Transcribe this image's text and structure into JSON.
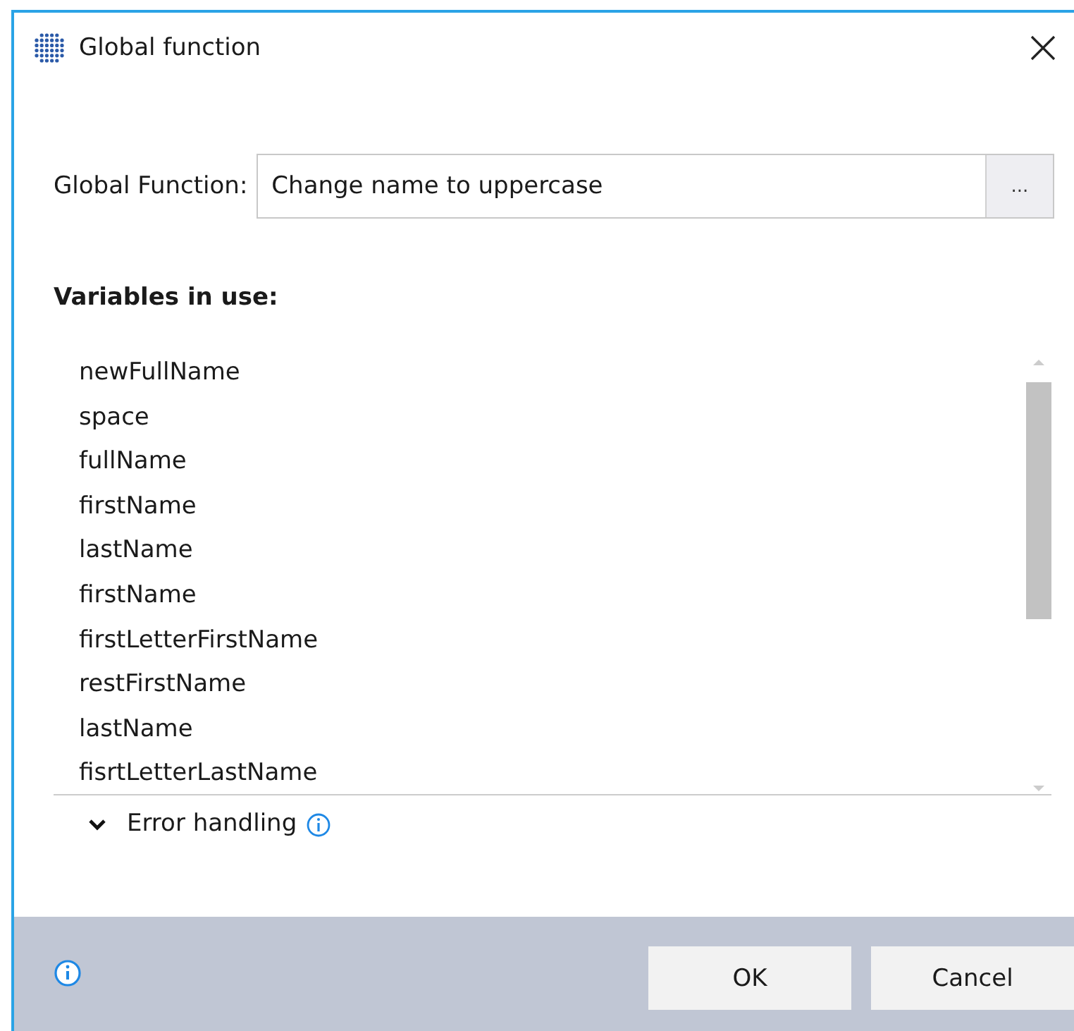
{
  "window": {
    "title": "Global function"
  },
  "global_function": {
    "label": "Global Function:",
    "value": "Change name to uppercase",
    "browse_button": "..."
  },
  "variables": {
    "heading": "Variables in use:",
    "items": [
      "newFullName",
      "space",
      "fullName",
      "firstName",
      "lastName",
      "firstName",
      "firstLetterFirstName",
      "restFirstName",
      "lastName",
      "fisrtLetterLastName"
    ]
  },
  "error_handling": {
    "label": "Error handling",
    "expanded": false
  },
  "buttons": [
    "OK",
    "Cancel"
  ]
}
